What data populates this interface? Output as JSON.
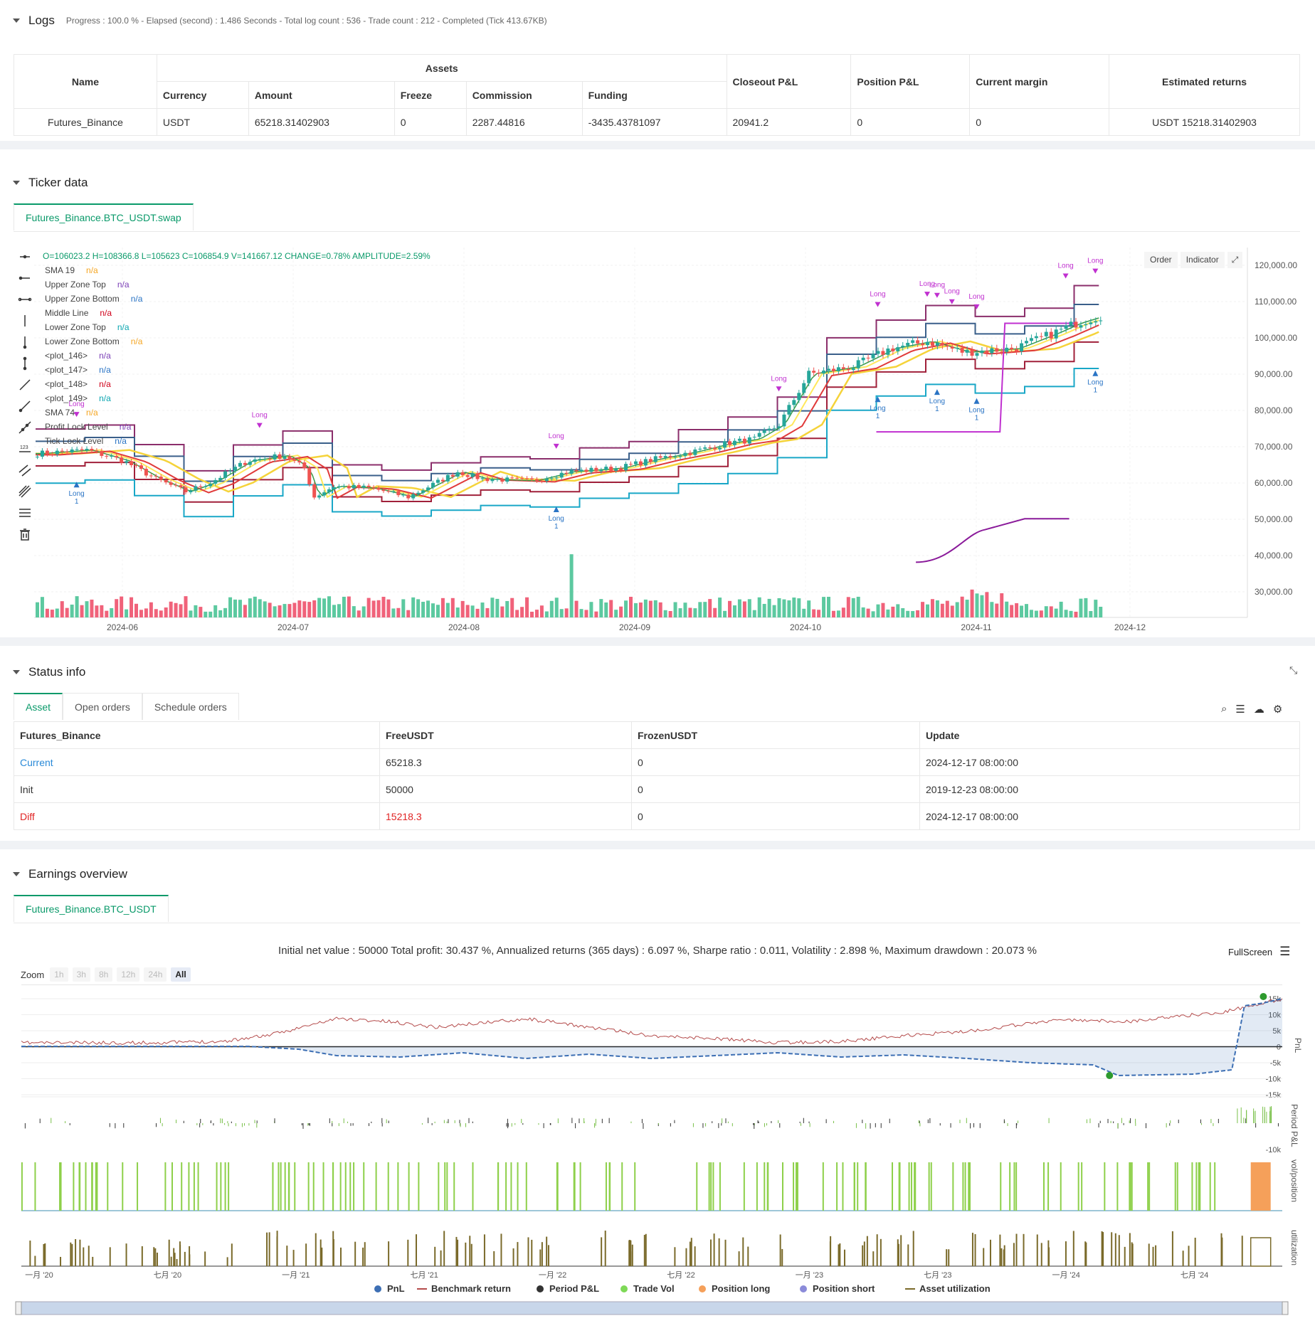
{
  "logs": {
    "title": "Logs",
    "summary": "Progress : 100.0 % - Elapsed (second) : 1.486  Seconds - Total log count : 536 - Trade count : 212 - Completed (Tick 413.67KB)",
    "table": {
      "headers": {
        "name": "Name",
        "assets": "Assets",
        "currency": "Currency",
        "amount": "Amount",
        "freeze": "Freeze",
        "commission": "Commission",
        "funding": "Funding",
        "closeout": "Closeout P&L",
        "position": "Position P&L",
        "margin": "Current margin",
        "returns": "Estimated returns"
      },
      "row": {
        "name": "Futures_Binance",
        "currency": "USDT",
        "amount": "65218.31402903",
        "freeze": "0",
        "commission": "2287.44816",
        "funding": "-3435.43781097",
        "closeout": "20941.2",
        "position": "0",
        "margin": "0",
        "returns": "USDT 15218.31402903"
      }
    }
  },
  "ticker": {
    "title": "Ticker data",
    "tab": "Futures_Binance.BTC_USDT.swap",
    "ohlc": "O=106023.2 H=108366.8 L=105623 C=106854.9 V=141667.12 CHANGE=0.78% AMPLITUDE=2.59%",
    "buttons": {
      "order": "Order",
      "indicator": "Indicator"
    },
    "legend": [
      {
        "label": "SMA 19",
        "value": "n/a",
        "color": "#f5a623"
      },
      {
        "label": "Upper Zone Top",
        "value": "n/a",
        "color": "#7b3fb6"
      },
      {
        "label": "Upper Zone Bottom",
        "value": "n/a",
        "color": "#2a74c5"
      },
      {
        "label": "Middle Line",
        "value": "n/a",
        "color": "#d0021b"
      },
      {
        "label": "Lower Zone Top",
        "value": "n/a",
        "color": "#0aa5b0"
      },
      {
        "label": "Lower Zone Bottom",
        "value": "n/a",
        "color": "#f5a623"
      },
      {
        "label": "<plot_146>",
        "value": "n/a",
        "color": "#7b3fb6"
      },
      {
        "label": "<plot_147>",
        "value": "n/a",
        "color": "#2a74c5"
      },
      {
        "label": "<plot_148>",
        "value": "n/a",
        "color": "#d0021b"
      },
      {
        "label": "<plot_149>",
        "value": "n/a",
        "color": "#0aa5b0"
      },
      {
        "label": "SMA 74",
        "value": "n/a",
        "color": "#f5a623"
      },
      {
        "label": "Profit Lock Level",
        "value": "n/a",
        "color": "#7b3fb6"
      },
      {
        "label": "Tick Lock Level",
        "value": "n/a",
        "color": "#2a74c5"
      }
    ],
    "y_ticks": [
      "120,000.00",
      "110,000.00",
      "100,000.00",
      "90,000.00",
      "80,000.00",
      "70,000.00",
      "60,000.00",
      "50,000.00",
      "40,000.00",
      "30,000.00"
    ],
    "x_ticks": [
      "2024-06",
      "2024-07",
      "2024-08",
      "2024-09",
      "2024-10",
      "2024-11",
      "2024-12"
    ],
    "signal_label": "Long",
    "signal_qty": "1"
  },
  "status": {
    "title": "Status info",
    "tabs": [
      "Asset",
      "Open orders",
      "Schedule orders"
    ],
    "headers": [
      "Futures_Binance",
      "FreeUSDT",
      "FrozenUSDT",
      "Update"
    ],
    "rows": [
      {
        "label": "Current",
        "free": "65218.3",
        "frozen": "0",
        "update": "2024-12-17 08:00:00"
      },
      {
        "label": "Init",
        "free": "50000",
        "frozen": "0",
        "update": "2019-12-23 08:00:00"
      },
      {
        "label": "Diff",
        "free": "15218.3",
        "frozen": "0",
        "update": "2024-12-17 08:00:00"
      }
    ]
  },
  "earnings": {
    "title": "Earnings overview",
    "tab": "Futures_Binance.BTC_USDT",
    "summary": "Initial net value : 50000  Total profit: 30.437 %, Annualized returns (365 days) : 6.097 %, Sharpe ratio : 0.011, Volatility : 2.898 %, Maximum drawdown : 20.073 %",
    "fullscreen": "FullScreen",
    "zoom_label": "Zoom",
    "zoom_buttons": [
      "1h",
      "3h",
      "8h",
      "12h",
      "24h",
      "All"
    ],
    "pnl_ticks": [
      "15k",
      "10k",
      "5k",
      "0",
      "-5k",
      "-10k",
      "-15k"
    ],
    "period_tick": "-10k",
    "axis_labels": {
      "pnl": "PnL",
      "period": "Period P&L",
      "vol": "vol/position",
      "util": "utilization"
    },
    "x_ticks": [
      "一月 '20",
      "七月 '20",
      "一月 '21",
      "七月 '21",
      "一月 '22",
      "七月 '22",
      "一月 '23",
      "七月 '23",
      "一月 '24",
      "七月 '24"
    ],
    "legend": [
      {
        "label": "PnL",
        "color": "#3d6fb4"
      },
      {
        "label": "Benchmark return",
        "color": "#b44b4b"
      },
      {
        "label": "Period P&L",
        "color": "#333333"
      },
      {
        "label": "Trade Vol",
        "color": "#7ed957"
      },
      {
        "label": "Position long",
        "color": "#f5a05a"
      },
      {
        "label": "Position short",
        "color": "#8b8bd9"
      },
      {
        "label": "Asset utilization",
        "color": "#7a6a2a"
      }
    ]
  }
}
